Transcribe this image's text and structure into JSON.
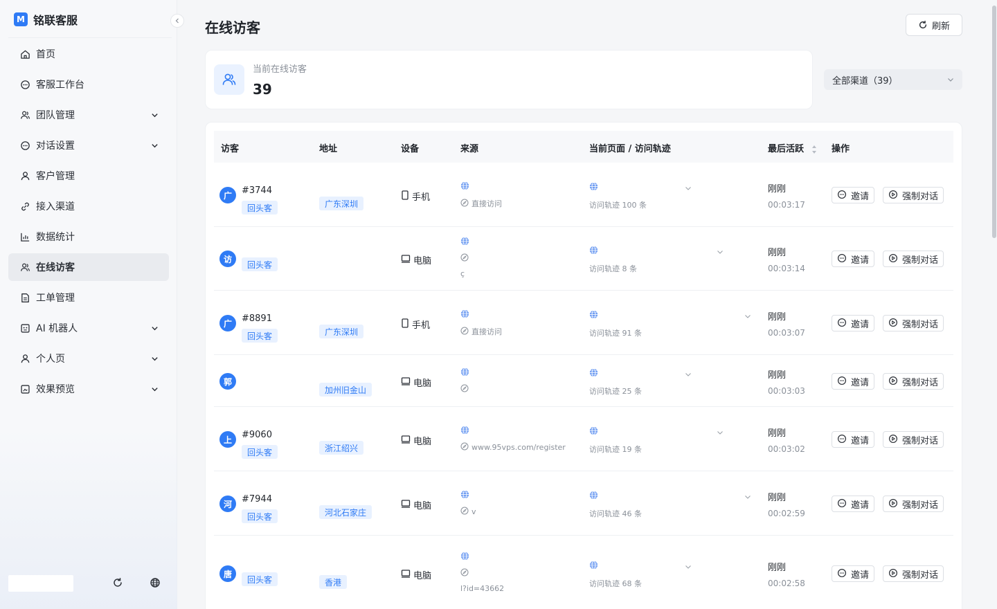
{
  "brand": {
    "logo_letter": "M",
    "name": "铭联客服"
  },
  "nav": {
    "items": [
      {
        "label": "首页",
        "icon": "home-icon",
        "expandable": false,
        "active": false
      },
      {
        "label": "客服工作台",
        "icon": "chat-bubble-icon",
        "expandable": false,
        "active": false
      },
      {
        "label": "团队管理",
        "icon": "team-icon",
        "expandable": true,
        "active": false
      },
      {
        "label": "对话设置",
        "icon": "chat-bubble-icon",
        "expandable": true,
        "active": false
      },
      {
        "label": "客户管理",
        "icon": "user-icon",
        "expandable": false,
        "active": false
      },
      {
        "label": "接入渠道",
        "icon": "link-icon",
        "expandable": false,
        "active": false
      },
      {
        "label": "数据统计",
        "icon": "bar-chart-icon",
        "expandable": false,
        "active": false
      },
      {
        "label": "在线访客",
        "icon": "team-icon",
        "expandable": false,
        "active": true
      },
      {
        "label": "工单管理",
        "icon": "document-icon",
        "expandable": false,
        "active": false
      },
      {
        "label": "AI 机器人",
        "icon": "robot-icon",
        "expandable": true,
        "active": false
      },
      {
        "label": "个人页",
        "icon": "user-icon",
        "expandable": true,
        "active": false
      },
      {
        "label": "效果预览",
        "icon": "preview-icon",
        "expandable": true,
        "active": false
      }
    ]
  },
  "header": {
    "title": "在线访客",
    "refresh_label": "刷新"
  },
  "stats": {
    "label": "当前在线访客",
    "value": "39"
  },
  "channel_select": {
    "value": "全部渠道（39）"
  },
  "table": {
    "columns": [
      "访客",
      "地址",
      "设备",
      "来源",
      "当前页面 / 访问轨迹",
      "最后活跃",
      "操作"
    ],
    "invite_label": "邀请",
    "force_label": "强制对话",
    "rows": [
      {
        "avatar": "广",
        "id": "#3744",
        "tag": "回头客",
        "address": "广东深圳",
        "device": "手机",
        "device_type": "phone",
        "source_text": "直接访问",
        "source_extra": "",
        "trail": "访问轨迹 100 条",
        "last_active": "刚刚",
        "duration": "00:03:17"
      },
      {
        "avatar": "访",
        "id": "",
        "tag": "回头客",
        "address": "",
        "device": "电脑",
        "device_type": "desktop",
        "source_text": "",
        "source_extra": "ç",
        "trail": "访问轨迹 8 条",
        "last_active": "刚刚",
        "duration": "00:03:14"
      },
      {
        "avatar": "广",
        "id": "#8891",
        "tag": "回头客",
        "address": "广东深圳",
        "device": "手机",
        "device_type": "phone",
        "source_text": "直接访问",
        "source_extra": "",
        "trail": "访问轨迹 91 条",
        "last_active": "刚刚",
        "duration": "00:03:07"
      },
      {
        "avatar": "郭",
        "id": "",
        "tag": "",
        "address": "加州旧金山",
        "device": "电脑",
        "device_type": "desktop",
        "source_text": "",
        "source_extra": "",
        "trail": "访问轨迹 25 条",
        "last_active": "刚刚",
        "duration": "00:03:03"
      },
      {
        "avatar": "上",
        "id": "#9060",
        "tag": "回头客",
        "address": "浙江绍兴",
        "device": "电脑",
        "device_type": "desktop",
        "source_text": "www.95vps.com/register",
        "source_extra": "",
        "trail": "访问轨迹 19 条",
        "last_active": "刚刚",
        "duration": "00:03:02"
      },
      {
        "avatar": "河",
        "id": "#7944",
        "tag": "回头客",
        "address": "河北石家庄",
        "device": "电脑",
        "device_type": "desktop",
        "source_text": "v",
        "source_extra": "",
        "trail": "访问轨迹 46 条",
        "last_active": "刚刚",
        "duration": "00:02:59"
      },
      {
        "avatar": "唐",
        "id": "",
        "tag": "回头客",
        "address": "香港",
        "device": "电脑",
        "device_type": "desktop",
        "source_text": "",
        "source_extra": "l?id=43662",
        "trail": "访问轨迹 68 条",
        "last_active": "刚刚",
        "duration": "00:02:58"
      }
    ]
  },
  "colors": {
    "accent": "#2f7bf5",
    "tag_bg": "#e8f1ff",
    "active_nav_bg": "#e9ebef"
  }
}
